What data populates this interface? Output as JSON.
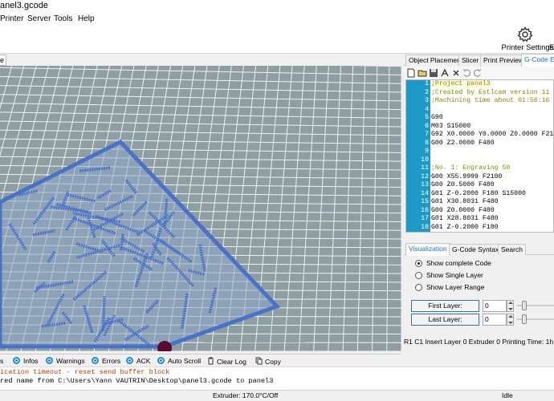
{
  "window": {
    "title": "anel3.gcode"
  },
  "menu": {
    "items": [
      "Printer",
      "Server",
      "Tools",
      "Help"
    ]
  },
  "toolbar": {
    "printer_settings_label": "Printer Settings",
    "edge_label": "E"
  },
  "view_tab_stub": "e",
  "right_tabs": [
    "Object Placement",
    "Slicer",
    "Print Preview",
    "G-Code Edi"
  ],
  "gcode_lines": [
    {
      "n": "1",
      "text": ";Project panel3",
      "comment": true
    },
    {
      "n": "2",
      "text": ";Created by Estlcam version 11",
      "comment": true
    },
    {
      "n": "3",
      "text": ";Machining time about 01:56:16",
      "comment": true
    },
    {
      "n": "4",
      "text": "",
      "comment": false
    },
    {
      "n": "5",
      "text": "G90",
      "comment": false
    },
    {
      "n": "6",
      "text": "M03 S15000",
      "comment": false
    },
    {
      "n": "7",
      "text": "G92 X0.0000 Y0.0000 Z0.0000 F21",
      "comment": false
    },
    {
      "n": "8",
      "text": "G00 Z2.0000 F480",
      "comment": false
    },
    {
      "n": "9",
      "text": "",
      "comment": false
    },
    {
      "n": "10",
      "text": "",
      "comment": false
    },
    {
      "n": "11",
      "text": ";No. 1: Engraving 50",
      "comment": true
    },
    {
      "n": "12",
      "text": "G00 X55.9999 F2100",
      "comment": false
    },
    {
      "n": "13",
      "text": "G00 Z0.5000 F480",
      "comment": false
    },
    {
      "n": "14",
      "text": "G01 Z-0.2000 F180 S15000",
      "comment": false
    },
    {
      "n": "15",
      "text": "G01 X30.8031 F480",
      "comment": false
    },
    {
      "n": "16",
      "text": "G00 Z0.0000 F480",
      "comment": false
    },
    {
      "n": "17",
      "text": "G01 X28.8031 F480",
      "comment": false
    },
    {
      "n": "18",
      "text": "G01 Z-0.2000 F180",
      "comment": false
    }
  ],
  "bottom_tabs": [
    "Visualization",
    "G-Code Syntax",
    "Search"
  ],
  "visualization": {
    "options": [
      "Show complete Code",
      "Show Single Layer",
      "Show Layer Range"
    ],
    "selected": 0,
    "first_layer_label": "First Layer:",
    "first_layer_value": "0",
    "last_layer_label": "Last Layer:",
    "last_layer_value": "0"
  },
  "editor_status": "R1  C1  Insert  Layer 0  Extruder 0  Printing Time: 1h:1",
  "log_bar": {
    "items": [
      "s",
      "Infos",
      "Warnings",
      "Errors",
      "ACK",
      "Auto Scroll",
      "Clear Log",
      "Copy"
    ]
  },
  "log_lines": [
    {
      "text": "ication timeout - reset send buffer block",
      "warn": true
    },
    {
      "text": "red name from C:\\Users\\Yann VAUTRIN\\Desktop\\panel3.gcode to panel3",
      "warn": false
    }
  ],
  "statusbar": {
    "extruder": "Extruder: 170.0°C/Off",
    "state": "Idle"
  },
  "colors": {
    "accent": "#1e9ac6",
    "grid": "#8aa3ab",
    "part": "#4a72c8"
  }
}
